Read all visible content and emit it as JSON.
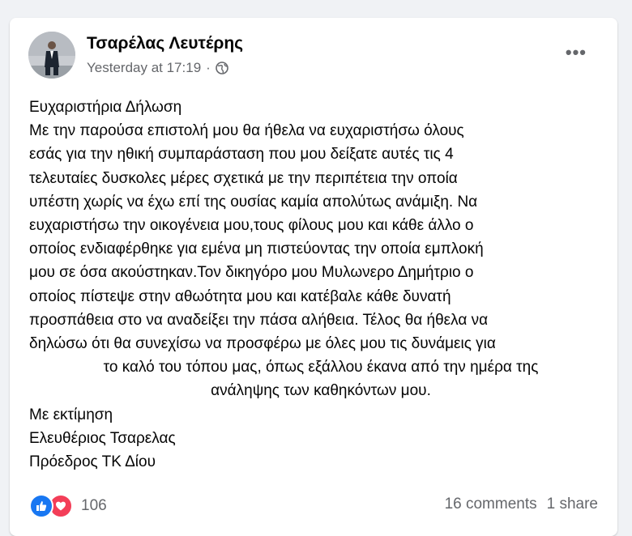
{
  "post": {
    "author": "Τσαρέλας Λευτέρης",
    "timestamp": "Yesterday at 17:19",
    "separator": "·",
    "visibility_icon": "globe-icon",
    "more_icon": "more-options-icon",
    "more_label": "•••",
    "lines": [
      "Ευχαριστήρια Δήλωση",
      "Με την παρούσα επιστολή μου θα ήθελα να ευχαριστήσω όλους",
      "εσάς για την ηθική συμπαράσταση που μου δείξατε αυτές τις 4",
      "τελευταίες δυσκολες μέρες σχετικά με την περιπέτεια την οποία",
      "υπέστη χωρίς να έχω επί της ουσίας καμία απολύτως ανάμιξη. Να",
      "ευχαριστήσω την οικογένεια μου,τους φίλους μου και κάθε άλλο ο",
      "οποίος ενδιαφέρθηκε για εμένα μη πιστεύοντας την οποία εμπλοκή",
      "μου σε όσα ακούστηκαν.Τον δικηγόρο μου Μυλωνερο Δημήτριο ο",
      "οποίος πίστεψε στην αθωότητα μου και κατέβαλε κάθε δυνατή",
      "προσπάθεια στο να αναδείξει την πάσα αλήθεια. Τέλος θα ήθελα να",
      "δηλώσω ότι θα συνεχίσω να προσφέρω με όλες μου τις δυνάμεις για",
      "το καλό του τόπου μας, όπως εξάλλου έκανα από την ημέρα της",
      "ανάληψης των καθηκόντων μου.",
      "Με εκτίμηση",
      "Ελευθέριος Τσαρελας",
      "Πρόεδρος ΤΚ Δίου"
    ]
  },
  "footer": {
    "reaction_icons": [
      "like-icon",
      "love-icon"
    ],
    "reaction_count": "106",
    "comments": "16 comments",
    "shares": "1 share"
  },
  "colors": {
    "background": "#f0f2f5",
    "card": "#ffffff",
    "secondary_text": "#65676b",
    "like_blue": "#1877f2",
    "love_red": "#f33e58"
  }
}
